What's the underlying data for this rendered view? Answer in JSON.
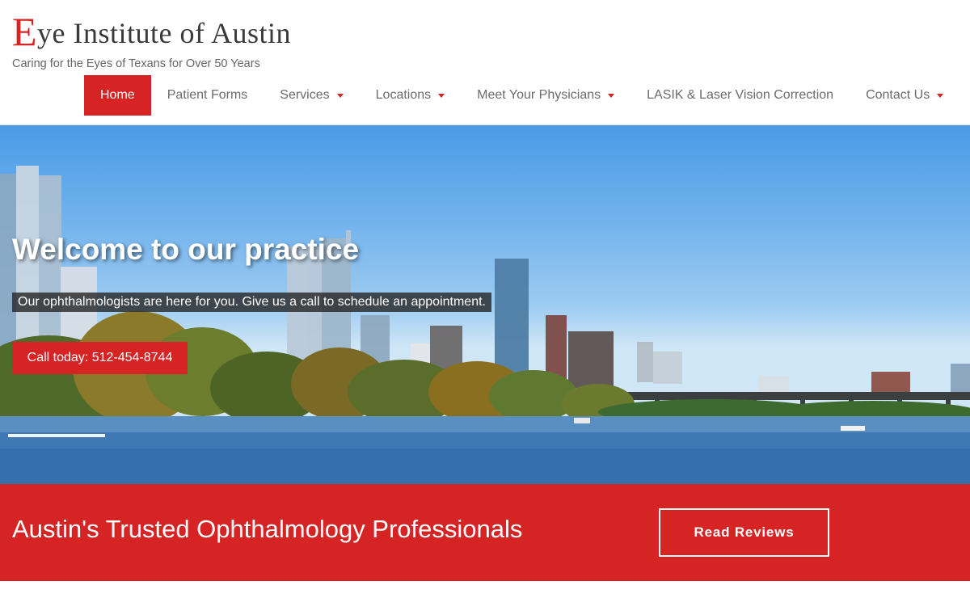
{
  "brand": {
    "logo_initial": "E",
    "logo_rest": "ye Institute of Austin",
    "tagline": "Caring for the Eyes of Texans for Over 50 Years"
  },
  "nav": {
    "items": [
      {
        "label": "Home",
        "active": true,
        "dropdown": false
      },
      {
        "label": "Patient Forms",
        "active": false,
        "dropdown": false
      },
      {
        "label": "Services",
        "active": false,
        "dropdown": true
      },
      {
        "label": "Locations",
        "active": false,
        "dropdown": true
      },
      {
        "label": "Meet Your Physicians",
        "active": false,
        "dropdown": true
      },
      {
        "label": "LASIK & Laser Vision Correction",
        "active": false,
        "dropdown": false
      },
      {
        "label": "Contact Us",
        "active": false,
        "dropdown": true
      }
    ]
  },
  "hero": {
    "title": "Welcome to our practice",
    "subtitle": "Our ophthalmologists are here for you. Give us a call to schedule an appointment.",
    "cta_label": "Call today: 512-454-8744"
  },
  "banner": {
    "text": "Austin's Trusted Ophthalmology Professionals",
    "button_label": "Read Reviews"
  },
  "colors": {
    "accent": "#d62424",
    "nav_text": "#6b6b6b",
    "white": "#ffffff"
  }
}
